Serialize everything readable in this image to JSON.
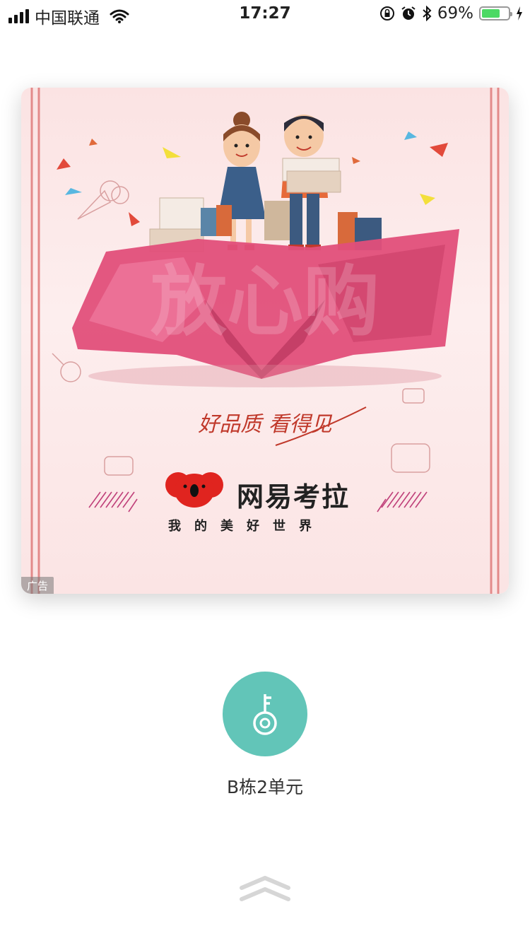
{
  "status_bar": {
    "carrier": "中国联通",
    "time": "17:27",
    "battery_percent": "69%",
    "battery_level": 0.69,
    "icons": [
      "signal-icon",
      "wifi-icon",
      "orientation-lock-icon",
      "alarm-icon",
      "bluetooth-icon",
      "battery-icon",
      "charging-icon"
    ]
  },
  "ad": {
    "headline": "放心购",
    "tagline": "好品质 看得见",
    "brand_name": "网易考拉",
    "brand_slogan": "我的美好世界",
    "badge": "广告"
  },
  "door": {
    "label": "B栋2单元",
    "icon": "key-icon",
    "color": "#62c5b8"
  },
  "swipe": {
    "icon": "double-chevron-up-icon"
  }
}
